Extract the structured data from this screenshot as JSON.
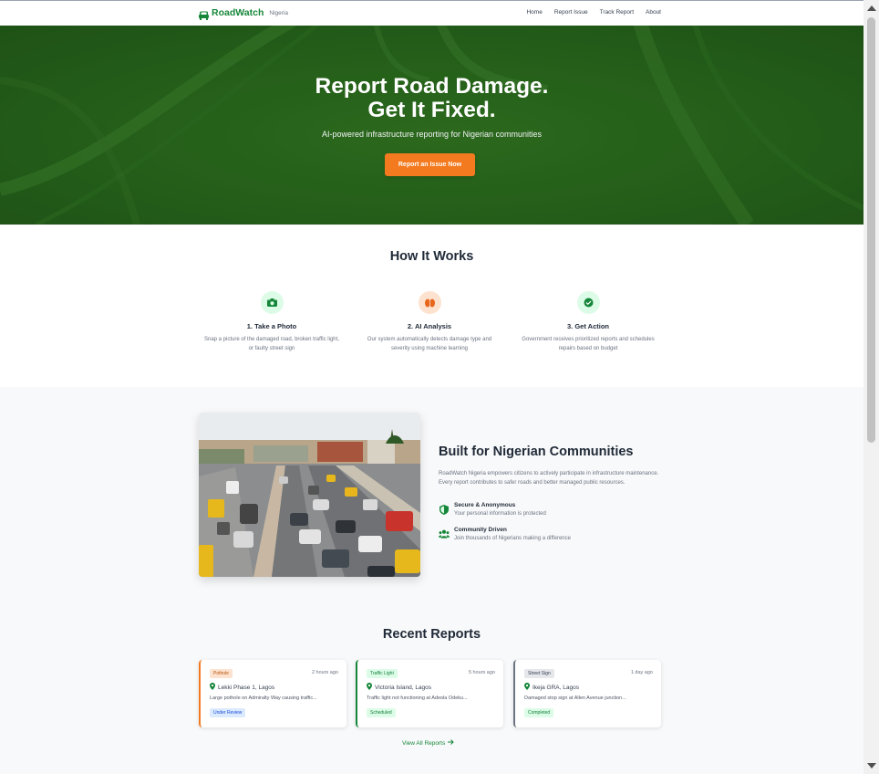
{
  "nav": {
    "brand": "RoadWatch",
    "brand_sub": "Nigeria",
    "links": [
      "Home",
      "Report Issue",
      "Track Report",
      "About"
    ]
  },
  "hero": {
    "title_line1": "Report Road Damage.",
    "title_line2": "Get It Fixed.",
    "subtitle": "AI-powered infrastructure reporting for Nigerian communities",
    "cta": "Report an Issue Now"
  },
  "how": {
    "title": "How It Works",
    "steps": [
      {
        "title": "1. Take a Photo",
        "desc": "Snap a picture of the damaged road, broken traffic light, or faulty street sign",
        "icon": "camera-icon"
      },
      {
        "title": "2. AI Analysis",
        "desc": "Our system automatically detects damage type and severity using machine learning",
        "icon": "brain-icon"
      },
      {
        "title": "3. Get Action",
        "desc": "Government receives prioritized reports and schedules repairs based on budget",
        "icon": "check-circle-icon"
      }
    ]
  },
  "about": {
    "title": "Built for Nigerian Communities",
    "desc": "RoadWatch Nigeria empowers citizens to actively participate in infrastructure maintenance. Every report contributes to safer roads and better managed public resources.",
    "features": [
      {
        "title": "Secure & Anonymous",
        "desc": "Your personal information is protected",
        "icon": "shield-icon"
      },
      {
        "title": "Community Driven",
        "desc": "Join thousands of Nigerians making a difference",
        "icon": "users-icon"
      }
    ]
  },
  "reports": {
    "title": "Recent Reports",
    "items": [
      {
        "tag": "Pothole",
        "time": "2 hours ago",
        "location": "Lekki Phase 1, Lagos",
        "desc": "Large pothole on Admiralty Way causing traffic...",
        "status": "Under Review"
      },
      {
        "tag": "Traffic Light",
        "time": "5 hours ago",
        "location": "Victoria Island, Lagos",
        "desc": "Traffic light not functioning at Adeola Odeku...",
        "status": "Scheduled"
      },
      {
        "tag": "Street Sign",
        "time": "1 day ago",
        "location": "Ikeja GRA, Lagos",
        "desc": "Damaged stop sign at Allen Avenue junction...",
        "status": "Completed"
      }
    ],
    "view_all": "View All Reports"
  },
  "colors": {
    "brand_green": "#16873a",
    "accent_orange": "#f47a1f",
    "hero_green": "#2f6f1f"
  }
}
